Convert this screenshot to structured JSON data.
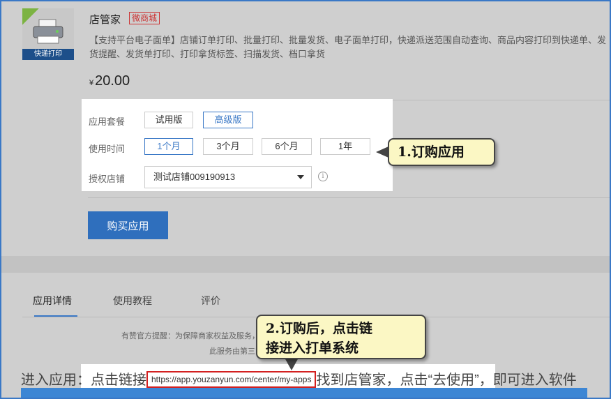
{
  "product": {
    "name": "店管家",
    "tag": "微商城",
    "thumb_label": "快递打印",
    "badge_icon": "free-trial-badge",
    "image_icon": "printer-icon",
    "description": "【支持平台电子面单】店铺订单打印、批量打印、批量发货、电子面单打印，快递派送范围自动查询、商品内容打印到快递单、发货提醒、发货单打印、打印拿货标签、扫描发货、档口拿货",
    "currency": "¥",
    "price": "20.00"
  },
  "options": {
    "package_label": "应用套餐",
    "packages": [
      "试用版",
      "高级版"
    ],
    "package_selected": "高级版",
    "duration_label": "使用时间",
    "durations": [
      "1个月",
      "3个月",
      "6个月",
      "1年"
    ],
    "duration_selected": "1个月",
    "store_label": "授权店铺",
    "store_value": "测试店铺009190913"
  },
  "buy_button": "购买应用",
  "callouts": {
    "one": "1.订购应用",
    "two_line1": "2.订购后，点击链",
    "two_line2": "接进入打单系统"
  },
  "tabs": [
    "应用详情",
    "使用教程",
    "评价"
  ],
  "notices": {
    "line1": "有赞官方提醒：为保障商家权益及服务，请在有赞应用市场内完成应用及服务订购",
    "line2": "此服务由第三方服务商提供"
  },
  "instruction": {
    "prefix": "进入应用：点击链接",
    "url": "https://app.youzanyun.com/center/my-apps",
    "suffix": "找到店管家，点击“去使用”，即可进入软件"
  },
  "colors": {
    "accent": "#3a78c6",
    "buy_button": "#2f6fbd",
    "tag_red": "#c33",
    "callout_bg": "#fbf7c4",
    "url_border": "#d32020"
  }
}
